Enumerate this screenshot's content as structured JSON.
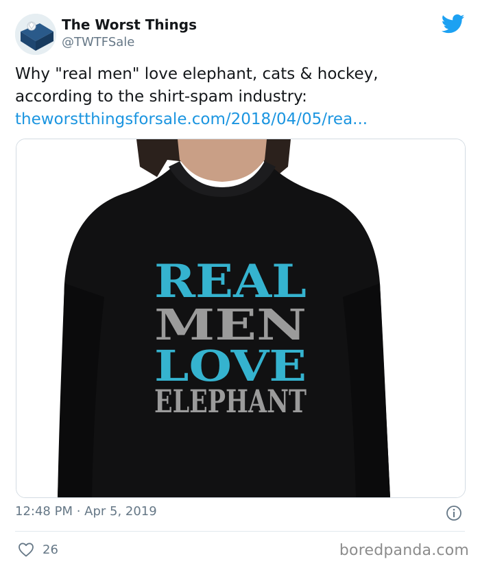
{
  "tweet": {
    "author_name": "The Worst Things",
    "author_handle": "@TWTFSale",
    "text_line1": "Why \"real men\" love elephant, cats & hockey,",
    "text_line2": "according to the shirt-spam industry:",
    "link_text": "theworstthingsforsale.com/2018/04/05/rea...",
    "timestamp": "12:48 PM · Apr 5, 2019",
    "like_count": "26"
  },
  "image": {
    "shirt_line1": "REAL",
    "shirt_line2": "MEN",
    "shirt_line3": "LOVE",
    "shirt_line4": "ELEPHANT"
  },
  "icons": {
    "brand": "twitter-bird-icon",
    "info": "info-icon",
    "like": "heart-icon"
  },
  "colors": {
    "link": "#1b95e0",
    "brand_blue": "#1da1f2",
    "shirt_teal": "#35b3cf",
    "shirt_gray": "#9b9b9b"
  },
  "watermark": "boredpanda.com"
}
